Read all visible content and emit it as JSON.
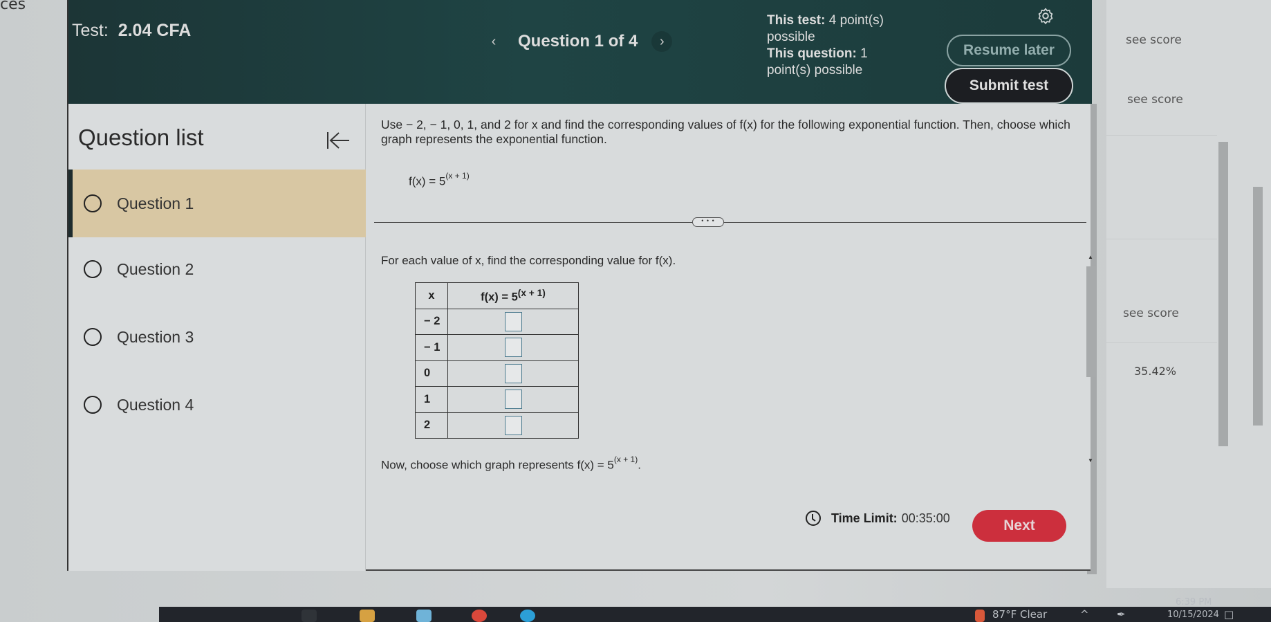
{
  "background": {
    "tab_fragment": "ces",
    "right_panel": {
      "see_score_labels": [
        "see score",
        "see score",
        "see score"
      ],
      "percentage": "35.42%"
    }
  },
  "header": {
    "test_label": "Test:",
    "test_name": "2.04 CFA",
    "question_counter": "Question 1 of 4",
    "prev_icon": "chevron-left-icon",
    "next_icon": "chevron-right-icon",
    "this_test_label": "This test:",
    "this_test_value": "4 point(s) possible",
    "this_question_label": "This question:",
    "this_question_value": "1 point(s) possible",
    "settings_icon": "gear-icon",
    "resume_later": "Resume later",
    "submit_test": "Submit test"
  },
  "sidebar": {
    "title": "Question list",
    "collapse_icon": "collapse-left-icon",
    "items": [
      {
        "label": "Question 1",
        "active": true
      },
      {
        "label": "Question 2",
        "active": false
      },
      {
        "label": "Question 3",
        "active": false
      },
      {
        "label": "Question 4",
        "active": false
      }
    ]
  },
  "question": {
    "instructions": "Use − 2, − 1, 0, 1, and 2 for x and find the corresponding values of f(x) for the following exponential function.  Then, choose which graph represents the exponential function.",
    "function_base": "f(x) = 5",
    "function_exponent": "(x + 1)",
    "more_button": "• • •",
    "prompt": "For each value of x, find the corresponding value for f(x).",
    "table": {
      "header_x": "x",
      "header_f_base": "f(x) = 5",
      "header_f_exponent": "(x + 1)",
      "rows": [
        {
          "x": "− 2",
          "fx": ""
        },
        {
          "x": "− 1",
          "fx": ""
        },
        {
          "x": "0",
          "fx": ""
        },
        {
          "x": "1",
          "fx": ""
        },
        {
          "x": "2",
          "fx": ""
        }
      ]
    },
    "graph_prompt_text": "Now, choose which graph represents ",
    "graph_prompt_base": "f(x) = 5",
    "graph_prompt_exponent": "(x + 1)",
    "graph_prompt_end": "."
  },
  "footer": {
    "time_limit_label": "Time Limit:",
    "time_limit_value": "00:35:00",
    "next_button": "Next"
  },
  "taskbar": {
    "weather": "87°F  Clear",
    "time": "6:39 PM",
    "date": "10/15/2024"
  },
  "colors": {
    "header_bg": "#1f4444",
    "active_question_bg": "#d8c7a3",
    "next_button": "#cc2f3d",
    "submit_button": "#1c1e22"
  }
}
